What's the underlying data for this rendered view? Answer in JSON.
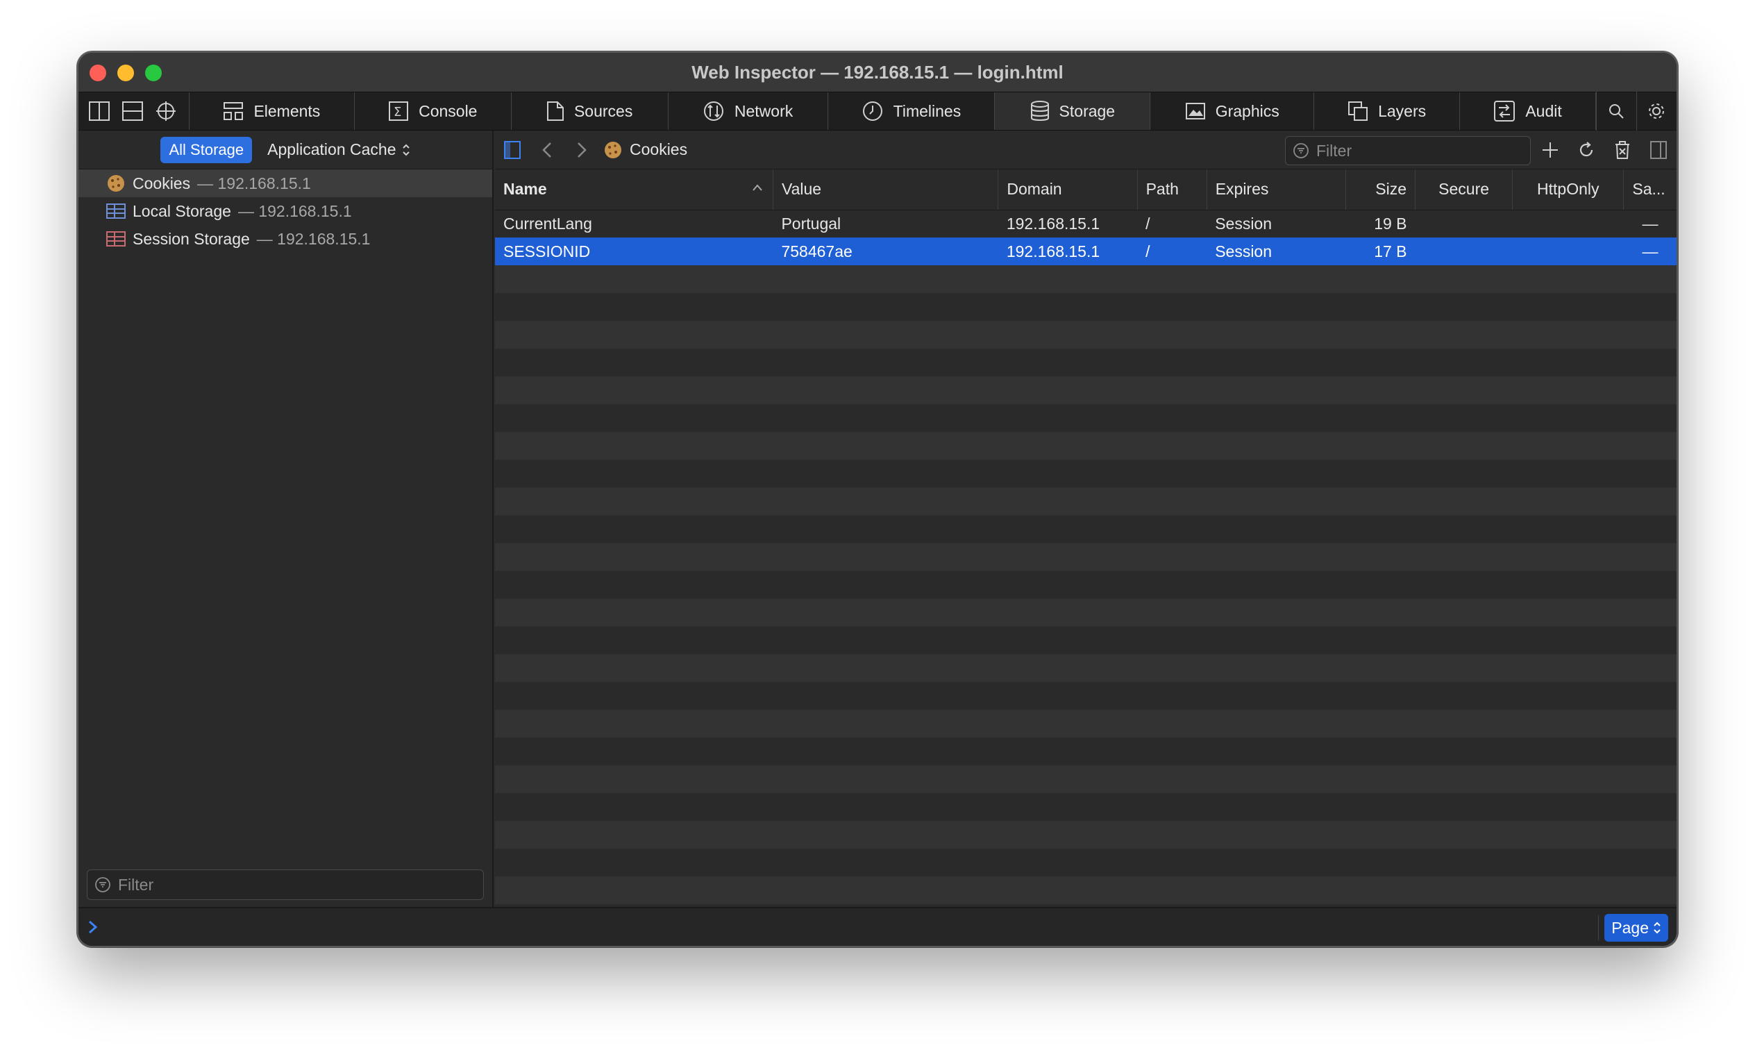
{
  "window": {
    "title": "Web Inspector — 192.168.15.1 — login.html"
  },
  "tabs": [
    {
      "label": "Elements",
      "icon": "elements-icon"
    },
    {
      "label": "Console",
      "icon": "console-icon"
    },
    {
      "label": "Sources",
      "icon": "sources-icon"
    },
    {
      "label": "Network",
      "icon": "network-icon"
    },
    {
      "label": "Timelines",
      "icon": "timelines-icon"
    },
    {
      "label": "Storage",
      "icon": "storage-icon",
      "active": true
    },
    {
      "label": "Graphics",
      "icon": "graphics-icon"
    },
    {
      "label": "Layers",
      "icon": "layers-icon"
    },
    {
      "label": "Audit",
      "icon": "audit-icon"
    }
  ],
  "sidebar": {
    "scope_all": "All Storage",
    "scope_cache": "Application Cache",
    "items": [
      {
        "label": "Cookies",
        "sub": " — 192.168.15.1",
        "icon": "cookie-icon",
        "selected": true
      },
      {
        "label": "Local Storage",
        "sub": " — 192.168.15.1",
        "icon": "local-storage-icon"
      },
      {
        "label": "Session Storage",
        "sub": " — 192.168.15.1",
        "icon": "session-storage-icon"
      }
    ],
    "filter_placeholder": "Filter"
  },
  "content": {
    "breadcrumb": "Cookies",
    "filter_placeholder": "Filter",
    "columns": [
      "Name",
      "Value",
      "Domain",
      "Path",
      "Expires",
      "Size",
      "Secure",
      "HttpOnly",
      "Sa..."
    ],
    "rows": [
      {
        "name": "CurrentLang",
        "value": "Portugal",
        "domain": "192.168.15.1",
        "path": "/",
        "expires": "Session",
        "size": "19 B",
        "secure": "",
        "httponly": "",
        "samesite": "—"
      },
      {
        "name": "SESSIONID",
        "value": "758467ae",
        "domain": "192.168.15.1",
        "path": "/",
        "expires": "Session",
        "size": "17 B",
        "secure": "",
        "httponly": "",
        "samesite": "—",
        "selected": true
      }
    ]
  },
  "bottom": {
    "page_label": "Page"
  },
  "colors": {
    "accent": "#1f5fd6",
    "pill": "#2e6fe0",
    "background": "#2a2a2a"
  }
}
